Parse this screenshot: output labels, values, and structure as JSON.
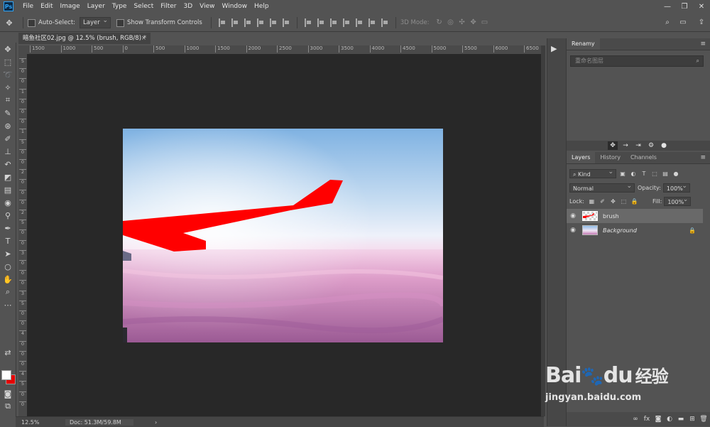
{
  "app": {
    "logo": "Ps"
  },
  "menu": [
    "File",
    "Edit",
    "Image",
    "Layer",
    "Type",
    "Select",
    "Filter",
    "3D",
    "View",
    "Window",
    "Help"
  ],
  "window_controls": [
    "—",
    "❐",
    "✕"
  ],
  "options_bar": {
    "auto_select_label": "Auto-Select:",
    "auto_select_target": "Layer",
    "show_transform_label": "Show Transform Controls",
    "mode_3d_label": "3D Mode:"
  },
  "document": {
    "tab_title": "暗鱼社区02.jpg @ 12.5% (brush, RGB/8) *",
    "close": "×"
  },
  "ruler_top": [
    "1500",
    "1000",
    "500",
    "0",
    "500",
    "1000",
    "1500",
    "2000",
    "2500",
    "3000",
    "3500",
    "4000",
    "4500",
    "5000",
    "5500",
    "6000",
    "6500"
  ],
  "ruler_left": [
    "5",
    "0",
    "0",
    "1",
    "0",
    "0",
    "0",
    "1",
    "5",
    "0",
    "0",
    "2",
    "0",
    "0",
    "0",
    "2",
    "5",
    "0",
    "0",
    "3",
    "0",
    "0",
    "0",
    "3",
    "5",
    "0",
    "0",
    "4",
    "0",
    "0",
    "0",
    "4",
    "5",
    "0",
    "0"
  ],
  "status": {
    "zoom": "12.5%",
    "doc": "Doc: 51.3M/59.8M",
    "arrow": "›"
  },
  "panel_strip": {
    "play": "▶"
  },
  "renamy_panel": {
    "title": "Renamy",
    "search_placeholder": "重命名图层"
  },
  "layers_panel": {
    "tabs": [
      "Layers",
      "History",
      "Channels"
    ],
    "filter_kind": "Kind",
    "blend_mode": "Normal",
    "opacity_label": "Opacity:",
    "opacity_value": "100%",
    "lock_label": "Lock:",
    "fill_label": "Fill:",
    "fill_value": "100%",
    "layers": [
      {
        "name": "brush",
        "selected": true,
        "locked": false
      },
      {
        "name": "Background",
        "selected": false,
        "locked": true
      }
    ]
  },
  "colors": {
    "foreground": "#ffffff",
    "background": "#e60000",
    "brush": "#ff0000"
  },
  "watermark": {
    "brand": "Bai",
    "brand2": "du",
    "cn": "经验",
    "url": "jingyan.baidu.com"
  }
}
